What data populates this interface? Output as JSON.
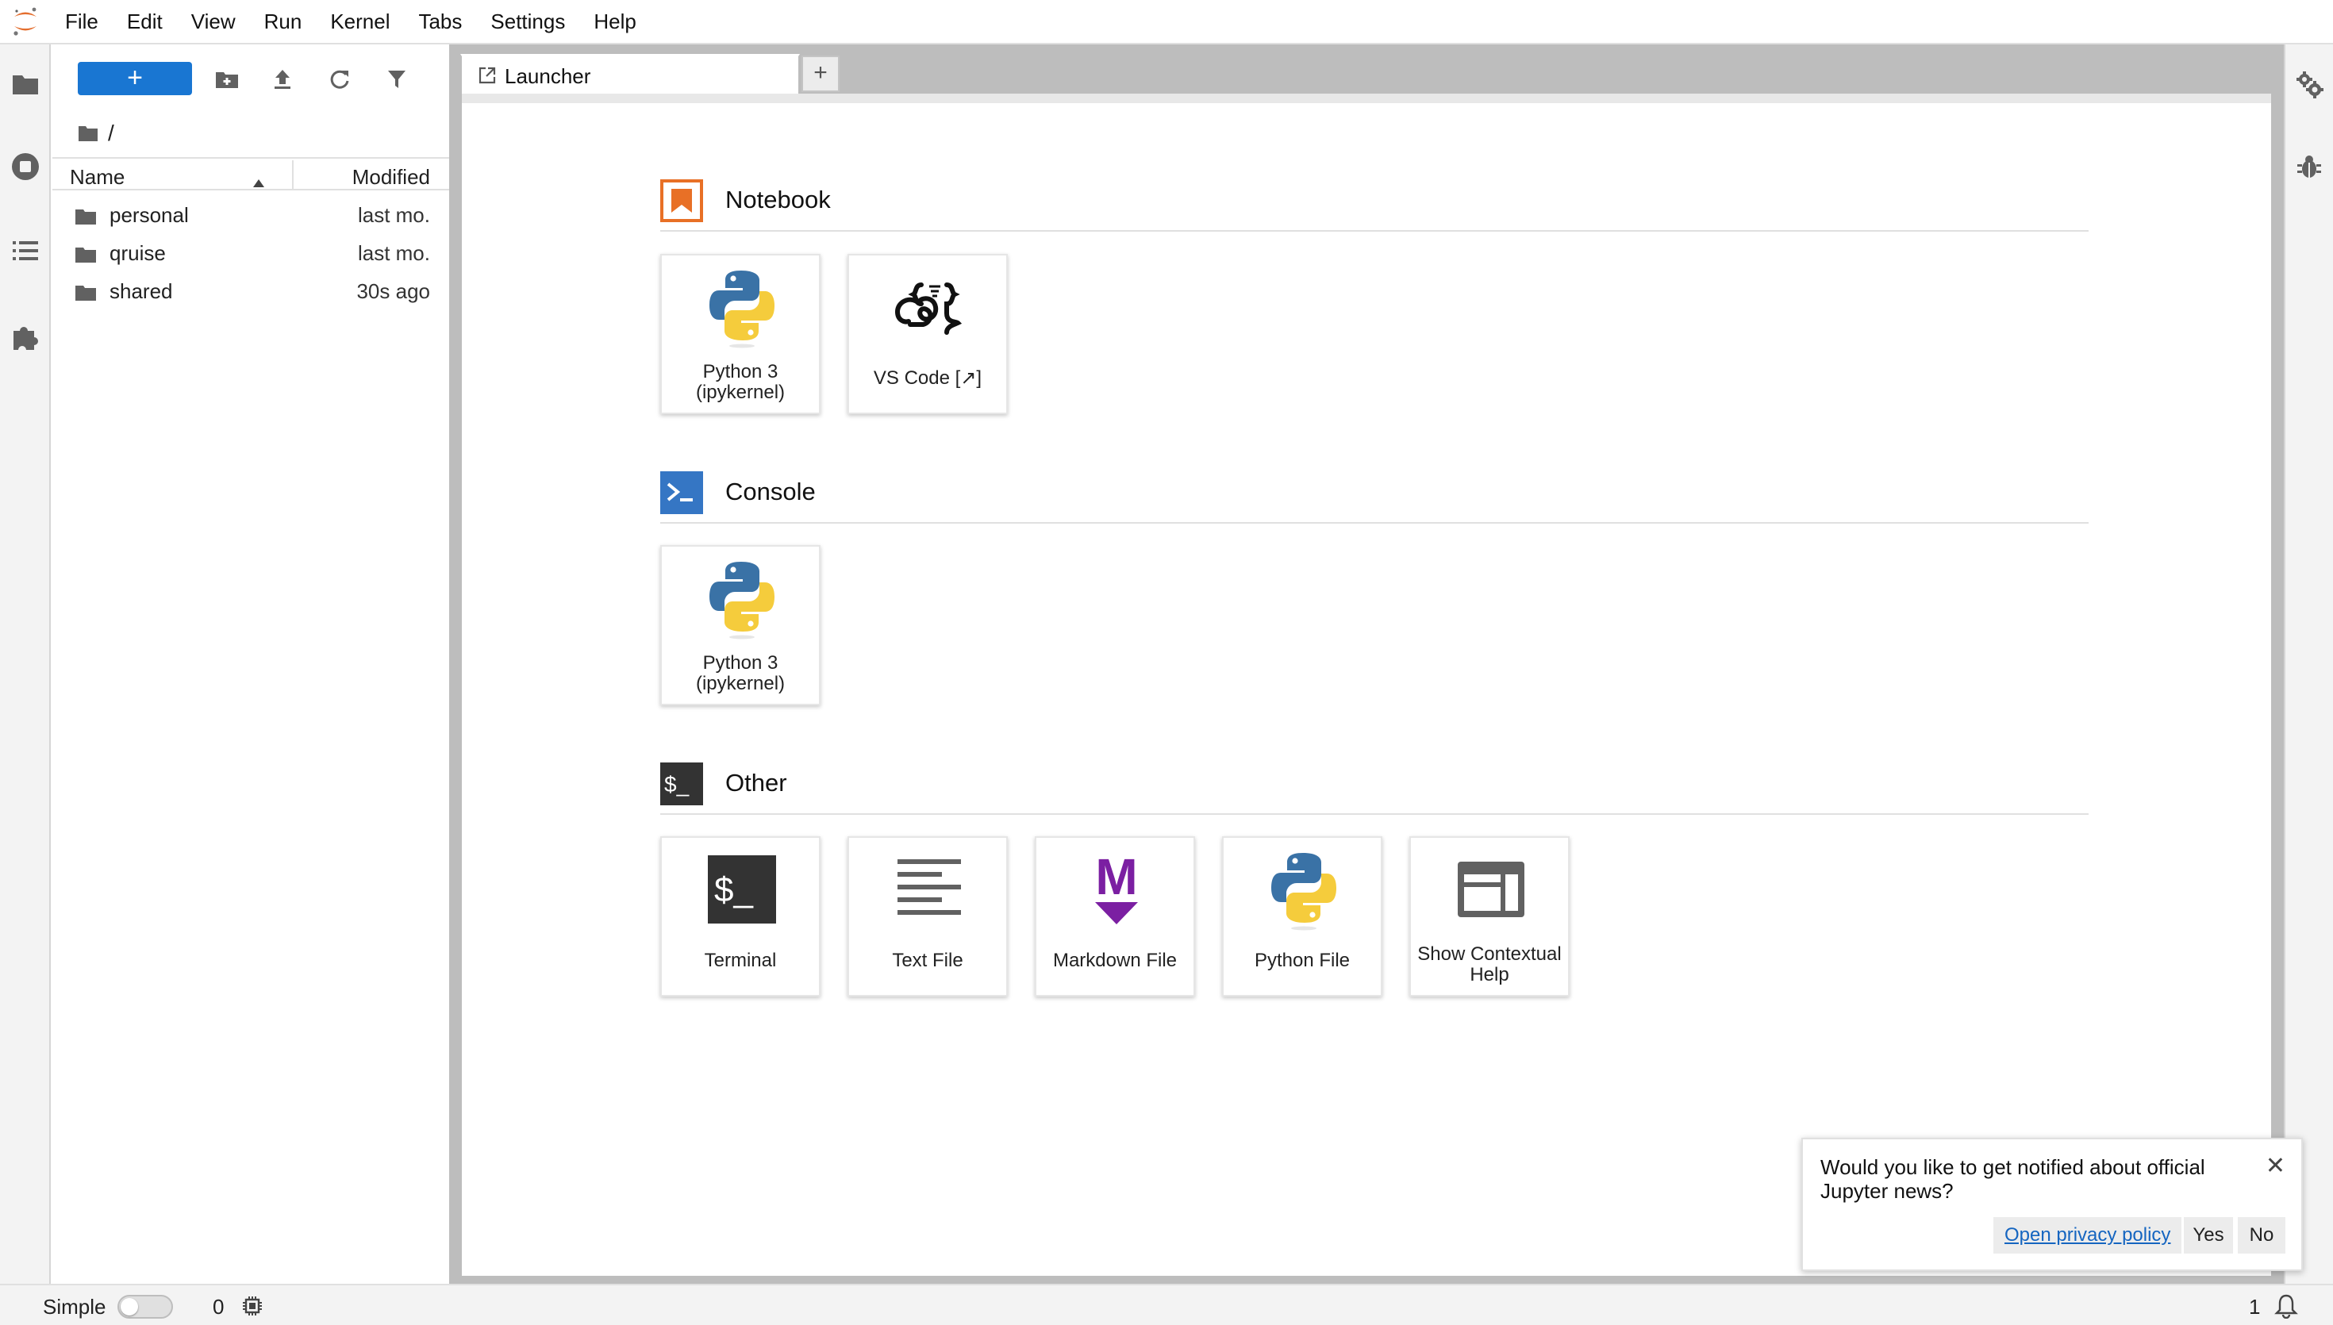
{
  "menubar": {
    "items": [
      "File",
      "Edit",
      "View",
      "Run",
      "Kernel",
      "Tabs",
      "Settings",
      "Help"
    ]
  },
  "filebrowser": {
    "new_button": "+",
    "breadcrumb": "/",
    "columns": {
      "name": "Name",
      "modified": "Modified"
    },
    "items": [
      {
        "name": "personal",
        "modified": "last mo."
      },
      {
        "name": "qruise",
        "modified": "last mo."
      },
      {
        "name": "shared",
        "modified": "30s ago"
      }
    ]
  },
  "tabs": {
    "active_label": "Launcher",
    "add_label": "+"
  },
  "launcher": {
    "sections": [
      {
        "title": "Notebook",
        "cards": [
          {
            "label": "Python 3 (ipykernel)",
            "icon": "python-icon"
          },
          {
            "label": "VS Code [↗]",
            "icon": "vscode-icon"
          }
        ]
      },
      {
        "title": "Console",
        "cards": [
          {
            "label": "Python 3 (ipykernel)",
            "icon": "python-icon"
          }
        ]
      },
      {
        "title": "Other",
        "terminal_glyph": "$_",
        "cards": [
          {
            "label": "Terminal",
            "icon": "terminal-icon"
          },
          {
            "label": "Text File",
            "icon": "text-file-icon"
          },
          {
            "label": "Markdown File",
            "icon": "markdown-icon",
            "glyph": "M"
          },
          {
            "label": "Python File",
            "icon": "python-icon"
          },
          {
            "label": "Show Contextual Help",
            "icon": "contextual-help-icon"
          }
        ]
      }
    ]
  },
  "statusbar": {
    "mode_label": "Simple",
    "simple_mode_on": false,
    "kernel_count": "0",
    "notification_count": "1"
  },
  "toast": {
    "message": "Would you like to get notified about official Jupyter news?",
    "privacy_link": "Open privacy policy",
    "yes": "Yes",
    "no": "No",
    "close": "✕"
  },
  "colors": {
    "accent": "#1976d2",
    "notebook": "#e87026",
    "console": "#3576c4",
    "other": "#333333",
    "markdown": "#7b1fa2",
    "python_blue": "#3a72a6",
    "python_yellow": "#f5cc3c"
  }
}
